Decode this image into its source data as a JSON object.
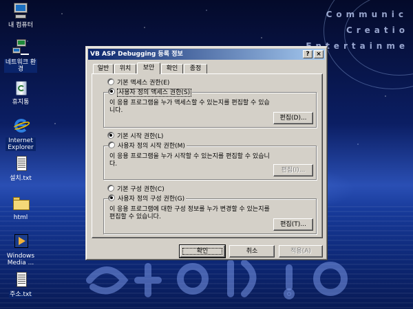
{
  "desktop": {
    "brand_lines": [
      "Communic",
      "Creatio",
      "Entertainme"
    ],
    "icons": [
      {
        "label": "내 컴퓨터",
        "icon": "my-computer-icon"
      },
      {
        "label": "네트워크 환경",
        "icon": "network-icon"
      },
      {
        "label": "휴지통",
        "icon": "recycle-bin-icon"
      },
      {
        "label": "Internet Explorer",
        "icon": "internet-explorer-icon"
      },
      {
        "label": "설치.txt",
        "icon": "text-file-icon"
      },
      {
        "label": "html",
        "icon": "folder-icon"
      },
      {
        "label": "Windows Media ...",
        "icon": "windows-media-icon"
      },
      {
        "label": "주소.txt",
        "icon": "text-file-icon"
      }
    ]
  },
  "dialog": {
    "title": "VB ASP Debugging 등록 정보",
    "help_btn": "?",
    "close_btn": "×",
    "tabs": [
      {
        "label": "일반",
        "active": false
      },
      {
        "label": "위치",
        "active": false
      },
      {
        "label": "보안",
        "active": true
      },
      {
        "label": "확인",
        "active": false
      },
      {
        "label": "종정",
        "active": false
      }
    ],
    "access": {
      "default_label": "기본 액세스 권한(E)",
      "custom_label": "사용자 정의 액세스 권한(S)",
      "description": "이 응용 프로그램을 누가 액세스할 수 있는지를 편집할 수 있습니다.",
      "edit_button": "편집(D)..."
    },
    "launch": {
      "default_label": "기본 시작 권한(L)",
      "custom_label": "사용자 정의 시작 권한(M)",
      "description": "이 응용 프로그램을 누가 시작할 수 있는지를 편집할 수 있습니다.",
      "edit_button": "편집(I)..."
    },
    "config": {
      "default_label": "기본 구성 권한(C)",
      "custom_label": "사용자 정의 구성 권한(G)",
      "description": "이 응용 프로그램에 대한 구성 정보를 누가 변경할 수 있는지를 편집할 수 있습니다.",
      "edit_button": "편집(T)..."
    },
    "footer": {
      "ok": "확인",
      "cancel": "취소",
      "apply": "적용(A)"
    }
  }
}
